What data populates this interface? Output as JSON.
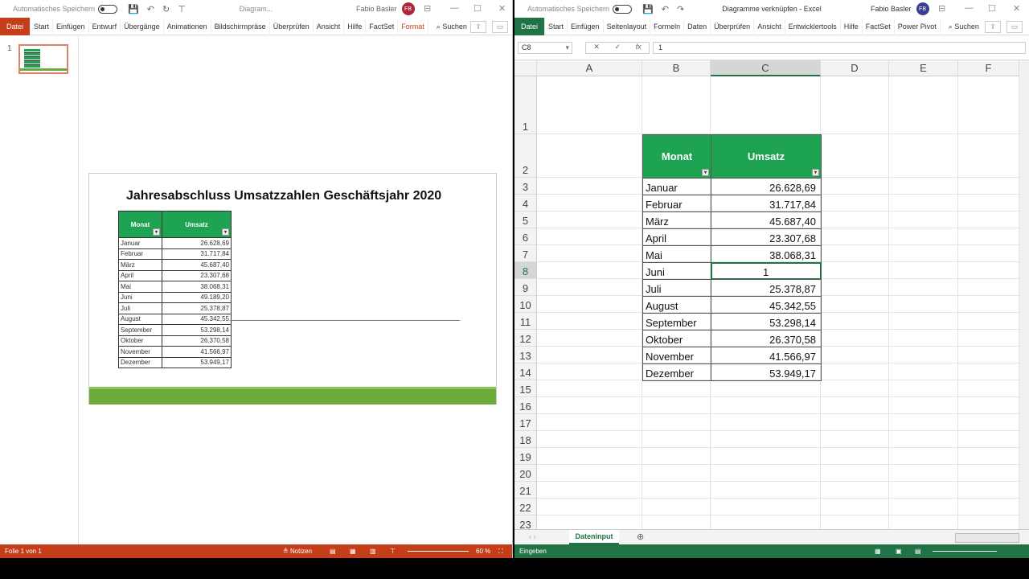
{
  "ppt": {
    "autosave": "Automatisches Speichern",
    "title": "Diagram...",
    "user": "Fabio Basler",
    "initials": "FB",
    "tabs": [
      "Datei",
      "Start",
      "Einfügen",
      "Entwurf",
      "Übergänge",
      "Animationen",
      "Bildschirmpräse",
      "Überprüfen",
      "Ansicht",
      "Hilfe",
      "FactSet",
      "Format"
    ],
    "search": "Suchen",
    "slide_number": "1",
    "slide_title": "Jahresabschluss Umsatzzahlen Geschäftsjahr 2020",
    "table_headers": [
      "Monat",
      "Umsatz"
    ],
    "rows": [
      [
        "Januar",
        "26.628,69"
      ],
      [
        "Februar",
        "31.717,84"
      ],
      [
        "März",
        "45.687,40"
      ],
      [
        "April",
        "23.307,68"
      ],
      [
        "Mai",
        "38.068,31"
      ],
      [
        "Juni",
        "49.189,20"
      ],
      [
        "Juli",
        "25.378,87"
      ],
      [
        "August",
        "45.342,55"
      ],
      [
        "September",
        "53.298,14"
      ],
      [
        "Oktober",
        "26.370,58"
      ],
      [
        "November",
        "41.566,97"
      ],
      [
        "Dezember",
        "53.949,17"
      ]
    ],
    "status": {
      "slide": "Folie 1 von 1",
      "notes": "Notizen",
      "zoom": "60 %"
    },
    "colors": {
      "accent": "#c43e1c",
      "table_header": "#1da352",
      "footer_bar": "#6aab3b"
    }
  },
  "excel": {
    "autosave": "Automatisches Speichern",
    "title": "Diagramme verknüpfen  -  Excel",
    "user": "Fabio Basler",
    "initials": "FB",
    "tabs": [
      "Datei",
      "Start",
      "Einfügen",
      "Seitenlayout",
      "Formeln",
      "Daten",
      "Überprüfen",
      "Ansicht",
      "Entwicklertools",
      "Hilfe",
      "FactSet",
      "Power Pivot"
    ],
    "search": "Suchen",
    "name_box": "C8",
    "formula": "1",
    "columns": [
      "A",
      "B",
      "C",
      "D",
      "E",
      "F"
    ],
    "table_headers": [
      "Monat",
      "Umsatz"
    ],
    "rows": [
      [
        "Januar",
        "26.628,69"
      ],
      [
        "Februar",
        "31.717,84"
      ],
      [
        "März",
        "45.687,40"
      ],
      [
        "April",
        "23.307,68"
      ],
      [
        "Mai",
        "38.068,31"
      ],
      [
        "Juni",
        "1"
      ],
      [
        "Juli",
        "25.378,87"
      ],
      [
        "August",
        "45.342,55"
      ],
      [
        "September",
        "53.298,14"
      ],
      [
        "Oktober",
        "26.370,58"
      ],
      [
        "November",
        "41.566,97"
      ],
      [
        "Dezember",
        "53.949,17"
      ]
    ],
    "sheet_tab": "Dateninput",
    "status": "Eingeben",
    "colors": {
      "accent": "#217346",
      "table_header": "#1da352"
    }
  }
}
